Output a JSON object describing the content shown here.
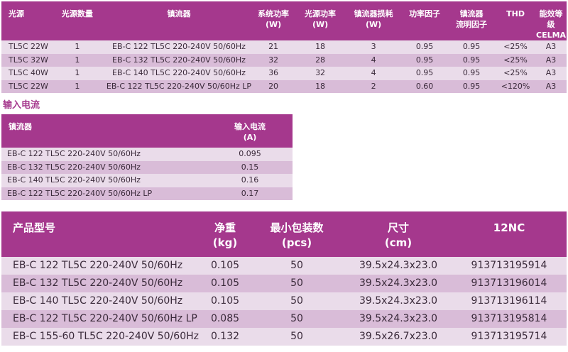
{
  "spec_table": {
    "headers": [
      [
        "光源"
      ],
      [
        "光源数量"
      ],
      [
        "镇流器"
      ],
      [
        "系统功率",
        "(W)"
      ],
      [
        "光源功率",
        "(W)"
      ],
      [
        "镇流器损耗",
        "(W)"
      ],
      [
        "功率因子"
      ],
      [
        "镇流器",
        "流明因子"
      ],
      [
        "THD"
      ],
      [
        "能效等级",
        "CELMA"
      ]
    ],
    "rows": [
      [
        "TL5C 22W",
        "1",
        "EB-C 122 TL5C 220-240V 50/60Hz",
        "21",
        "18",
        "3",
        "0.95",
        "0.95",
        "<25%",
        "A3"
      ],
      [
        "TL5C 32W",
        "1",
        "EB-C 132 TL5C 220-240V 50/60Hz",
        "32",
        "28",
        "4",
        "0.95",
        "0.95",
        "<25%",
        "A3"
      ],
      [
        "TL5C 40W",
        "1",
        "EB-C 140 TL5C 220-240V 50/60Hz",
        "36",
        "32",
        "4",
        "0.95",
        "0.95",
        "<25%",
        "A3"
      ],
      [
        "TL5C 22W",
        "1",
        "EB-C 122 TL5C 220-240V 50/60Hz LP",
        "20",
        "18",
        "2",
        "0.60",
        "0.95",
        "<120%",
        "A3"
      ]
    ]
  },
  "input_current": {
    "title": "输入电流",
    "headers": [
      [
        "镇流器"
      ],
      [
        "输入电流",
        "(A)"
      ]
    ],
    "rows": [
      [
        "EB-C 122 TL5C 220-240V 50/60Hz",
        "0.095"
      ],
      [
        "EB-C 132 TL5C 220-240V 50/60Hz",
        "0.15"
      ],
      [
        "EB-C 140 TL5C 220-240V 50/60Hz",
        "0.16"
      ],
      [
        "EB-C 122 TL5C 220-240V 50/60Hz LP",
        "0.17"
      ]
    ]
  },
  "product_table": {
    "headers": [
      [
        "产品型号"
      ],
      [
        "净重",
        "(kg)"
      ],
      [
        "最小包装数",
        "(pcs)"
      ],
      [
        "尺寸",
        "(cm)"
      ],
      [
        "12NC"
      ]
    ],
    "rows": [
      [
        "EB-C 122 TL5C 220-240V 50/60Hz",
        "0.105",
        "50",
        "39.5x24.3x23.0",
        "913713195914"
      ],
      [
        "EB-C 132 TL5C 220-240V 50/60Hz",
        "0.105",
        "50",
        "39.5x24.3x23.0",
        "913713196014"
      ],
      [
        "EB-C 140 TL5C 220-240V 50/60Hz",
        "0.105",
        "50",
        "39.5x24.3x23.0",
        "913713196114"
      ],
      [
        "EB-C 122 TL5C 220-240V 50/60Hz LP",
        "0.085",
        "50",
        "39.5x24.3x23.0",
        "913713195814"
      ],
      [
        "EB-C 155-60 TL5C 220-240V 50/60Hz",
        "0.132",
        "50",
        "39.5x26.7x23.0",
        "913713195714"
      ]
    ]
  },
  "colors": {
    "header_bg": "#a5388d",
    "row_light": "#eadcea",
    "row_dark": "#d9bcd8",
    "section_title": "#a5388d"
  }
}
